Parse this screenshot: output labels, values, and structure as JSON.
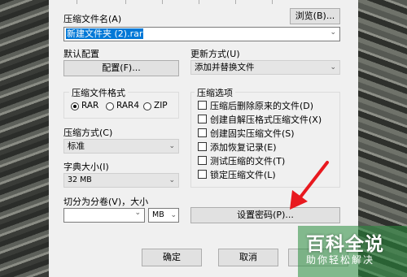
{
  "archive_name_label": "压缩文件名(A)",
  "archive_name_value": "新建文件夹 (2).rar",
  "browse_button": "浏览(B)...",
  "default_profile_label": "默认配置",
  "profile_button": "配置(F)...",
  "update_mode_label": "更新方式(U)",
  "update_mode_value": "添加并替换文件",
  "format_group_title": "压缩文件格式",
  "formats": [
    "RAR",
    "RAR4",
    "ZIP"
  ],
  "selected_format": "RAR",
  "options_group_title": "压缩选项",
  "options": [
    {
      "label": "压缩后删除原来的文件(D)",
      "checked": false
    },
    {
      "label": "创建自解压格式压缩文件(X)",
      "checked": false
    },
    {
      "label": "创建固实压缩文件(S)",
      "checked": false
    },
    {
      "label": "添加恢复记录(E)",
      "checked": false
    },
    {
      "label": "测试压缩的文件(T)",
      "checked": false
    },
    {
      "label": "锁定压缩文件(L)",
      "checked": false
    }
  ],
  "compression_method_label": "压缩方式(C)",
  "compression_method_value": "标准",
  "dictionary_label": "字典大小(I)",
  "dictionary_value": "32 MB",
  "split_label": "切分为分卷(V)，大小",
  "split_value": "",
  "split_unit": "MB",
  "password_button": "设置密码(P)...",
  "ok_button": "确定",
  "cancel_button": "取消",
  "watermark_title": "百科全说",
  "watermark_subtitle": "助你轻松解决",
  "colors": {
    "accent": "#0078d7",
    "arrow": "#e8191f",
    "watermark": "#ffffff"
  }
}
